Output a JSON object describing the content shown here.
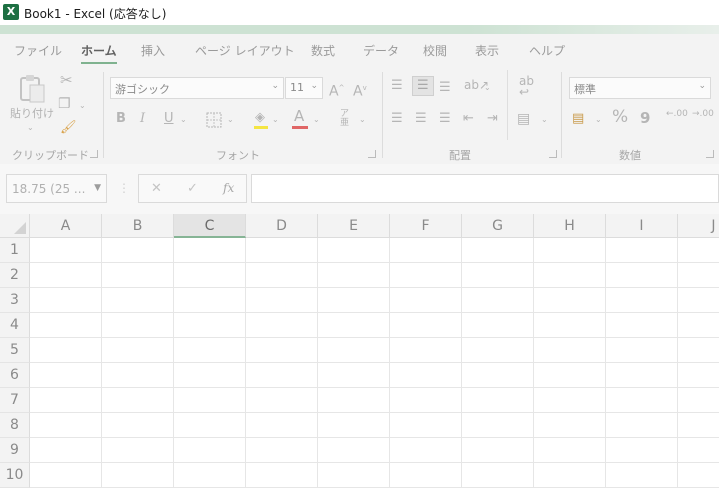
{
  "window": {
    "title": "Book1 - Excel (応答なし)",
    "app_icon_letter": "X",
    "accent_color": "#1d6f42"
  },
  "ribbon": {
    "tabs": [
      {
        "label": "ファイル",
        "active": false
      },
      {
        "label": "ホーム",
        "active": true
      },
      {
        "label": "挿入",
        "active": false
      },
      {
        "label": "ページ レイアウト",
        "active": false
      },
      {
        "label": "数式",
        "active": false
      },
      {
        "label": "データ",
        "active": false
      },
      {
        "label": "校閲",
        "active": false
      },
      {
        "label": "表示",
        "active": false
      },
      {
        "label": "ヘルプ",
        "active": false
      }
    ],
    "clipboard": {
      "group_label": "クリップボード",
      "paste_label": "貼り付け"
    },
    "font": {
      "group_label": "フォント",
      "font_name": "游ゴシック",
      "font_size": "11",
      "highlight_color": "#f4e542",
      "font_color": "#e06666"
    },
    "alignment": {
      "group_label": "配置"
    },
    "number": {
      "group_label": "数値",
      "format": "標準",
      "percent_glyph": "%",
      "comma_glyph": "9",
      "inc_decimal": ".00",
      "dec_decimal": ".00"
    }
  },
  "formula_bar": {
    "name_box": "18.75 (25 ...",
    "fx_label": "fx",
    "formula": ""
  },
  "sheet": {
    "columns": [
      "A",
      "B",
      "C",
      "D",
      "E",
      "F",
      "G",
      "H",
      "I",
      "J"
    ],
    "selected_column": "C",
    "rows": [
      "1",
      "2",
      "3",
      "4",
      "5",
      "6",
      "7",
      "8",
      "9",
      "10"
    ]
  }
}
